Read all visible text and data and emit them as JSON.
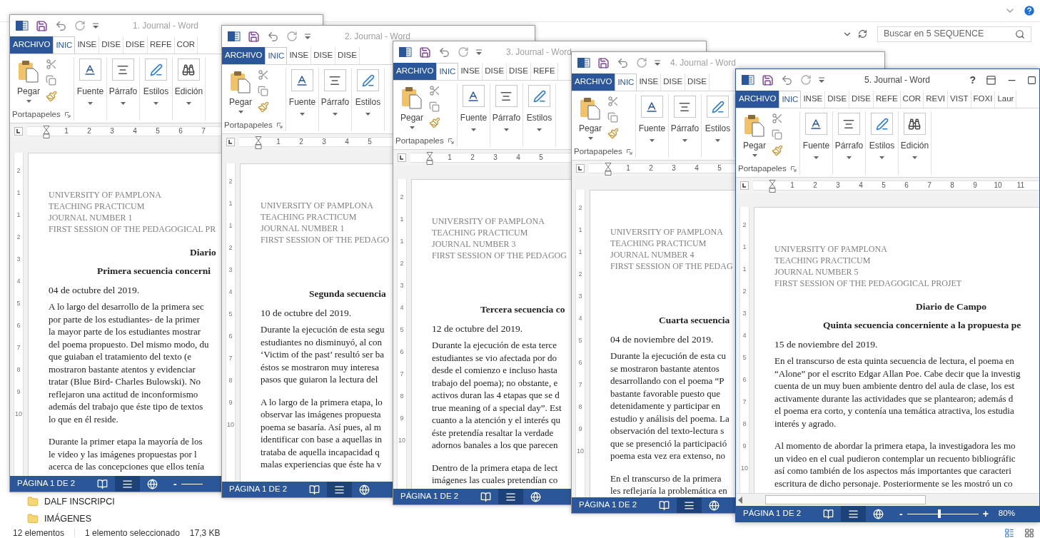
{
  "explorer": {
    "search": {
      "placeholder": "Buscar en 5 SEQUENCE"
    },
    "folders": [
      {
        "name": "DALF INSCRIPCI"
      },
      {
        "name": "IMÁGENES"
      }
    ],
    "status": {
      "count": "12 elementos",
      "selection": "1 elemento seleccionado",
      "size": "17,3 KB"
    }
  },
  "windows": [
    {
      "title": "1. Journal - Word",
      "active": false,
      "tabs": [
        {
          "label": "ARCHIVO",
          "kind": "file",
          "selected": false
        },
        {
          "label": "INIC",
          "kind": "tab",
          "selected": true
        },
        {
          "label": "INSE",
          "kind": "tab",
          "selected": false
        },
        {
          "label": "DISE",
          "kind": "tab",
          "selected": false
        },
        {
          "label": "DISE",
          "kind": "tab",
          "selected": false
        },
        {
          "label": "REFE",
          "kind": "tab",
          "selected": false
        },
        {
          "label": "COR",
          "kind": "tab",
          "selected": false
        }
      ],
      "clipboard": {
        "paste": "Pegar",
        "group": "Portapapeles"
      },
      "commands": [
        {
          "label": "Fuente",
          "kind": "font"
        },
        {
          "label": "Párrafo",
          "kind": "paragraph"
        },
        {
          "label": "Estilos",
          "kind": "styles"
        },
        {
          "label": "Edición",
          "kind": "editing"
        }
      ],
      "ruler": [
        "1",
        "2",
        "3",
        "4",
        "5",
        "6",
        "7"
      ],
      "vruler": [
        "2",
        "1",
        "1",
        "2",
        "3",
        "4",
        "5",
        "6",
        "7",
        "8",
        "9",
        "10"
      ],
      "document": {
        "header": [
          "UNIVERSITY OF PAMPLONA",
          "TEACHING PRACTICUM",
          "JOURNAL NUMBER 1",
          "FIRST SESSION OF THE PEDAGOGICAL PR"
        ],
        "title": "Diario",
        "subtitle": "Primera secuencia concerni",
        "date": "04 de octubre del 2019.",
        "paragraphs": [
          [
            "A lo largo del desarrollo de la primera sec",
            "por parte de los estudiantes- de la primer",
            "la mayor parte de los estudiantes mostrar",
            "del poema propuesto. Del mismo modo, du",
            "que guiaban el tratamiento del texto (e",
            "mostraron bastante atentos y evidenciar",
            "tratar (Blue Bird- Charles Bulowski). No",
            "reflejaron una actitud de inconformismo",
            "además del trabajo que éste tipo de textos",
            "lo que en él reside."
          ],
          [
            "Durante la primer etapa la mayoría de los",
            "le video y las imágenes propuestas por l",
            "acerca de las concepciones que ellos tenía"
          ]
        ]
      },
      "status": {
        "page": "PÁGINA 1 DE 2",
        "views": [
          {
            "kind": "read",
            "selected": false
          },
          {
            "kind": "print",
            "selected": true
          },
          {
            "kind": "web",
            "selected": false
          }
        ],
        "zoom": {
          "minus": "-"
        }
      }
    },
    {
      "title": "2. Journal - Word",
      "active": false,
      "tabs": [
        {
          "label": "ARCHIVO",
          "kind": "file",
          "selected": false
        },
        {
          "label": "INIC",
          "kind": "tab",
          "selected": true
        },
        {
          "label": "INSE",
          "kind": "tab",
          "selected": false
        },
        {
          "label": "DISE",
          "kind": "tab",
          "selected": false
        },
        {
          "label": "DISE",
          "kind": "tab",
          "selected": false
        }
      ],
      "clipboard": {
        "paste": "Pegar",
        "group": "Portapapeles"
      },
      "commands": [
        {
          "label": "Fuente",
          "kind": "font"
        },
        {
          "label": "Párrafo",
          "kind": "paragraph"
        },
        {
          "label": "Estilos",
          "kind": "styles"
        }
      ],
      "ruler": [
        "1",
        "2",
        "3",
        "4",
        "5"
      ],
      "vruler": [
        "2",
        "1",
        "1",
        "2",
        "3",
        "4",
        "5",
        "6",
        "7",
        "8",
        "9",
        "10"
      ],
      "document": {
        "header": [
          "UNIVERSITY OF PAMPLONA",
          "TEACHING PRACTICUM",
          "JOURNAL NUMBER 1",
          "FIRST SESSION OF THE PEDAGO"
        ],
        "subtitle": "Segunda secuencia",
        "date": "10 de octubre del 2019.",
        "paragraphs": [
          [
            "Durante la ejecución de esta segu",
            "estudiantes no disminuyó, al con",
            "‘Victim of the past’ resultó ser ba",
            "éstos se mostraron muy interesa",
            "pasos que guiaron la lectura del"
          ],
          [
            "A lo largo de la primera etapa, lo",
            "observar las imágenes propuesta",
            "poema se basaría. Así pues, al m",
            "identificar con base a aquellas in",
            "trataba de aquella incapacidad q",
            "malas experiencias que éste ha v"
          ]
        ]
      },
      "status": {
        "page": "PÁGINA 1 DE 2",
        "views": [
          {
            "kind": "read",
            "selected": false
          },
          {
            "kind": "print",
            "selected": true
          },
          {
            "kind": "web",
            "selected": false
          }
        ]
      }
    },
    {
      "title": "3. Journal - Word",
      "active": false,
      "tabs": [
        {
          "label": "ARCHIVO",
          "kind": "file",
          "selected": false
        },
        {
          "label": "INIC",
          "kind": "tab",
          "selected": true
        },
        {
          "label": "INSE",
          "kind": "tab",
          "selected": false
        },
        {
          "label": "DISE",
          "kind": "tab",
          "selected": false
        },
        {
          "label": "DISE",
          "kind": "tab",
          "selected": false
        },
        {
          "label": "REFE",
          "kind": "tab",
          "selected": false
        }
      ],
      "clipboard": {
        "paste": "Pegar",
        "group": "Portapapeles"
      },
      "commands": [
        {
          "label": "Fuente",
          "kind": "font"
        },
        {
          "label": "Párrafo",
          "kind": "paragraph"
        },
        {
          "label": "Estilos",
          "kind": "styles"
        }
      ],
      "ruler": [
        "1",
        "2",
        "3",
        "4",
        "5"
      ],
      "vruler": [
        "2",
        "1",
        "1",
        "2",
        "3",
        "4",
        "5",
        "6",
        "7",
        "8",
        "9",
        "10"
      ],
      "document": {
        "header": [
          "UNIVERSITY OF PAMPLONA",
          "TEACHING PRACTICUM",
          "JOURNAL NUMBER 3",
          "FIRST SESSION OF THE PEDAGOG"
        ],
        "subtitle": "Tercera secuencia co",
        "date": "12 de octubre del 2019.",
        "paragraphs": [
          [
            "Durante la ejecución de esta terce",
            "estudiantes se vio afectada por do",
            "desde el comienzo e incluso hasta",
            "trabajo del poema); no obstante, e",
            "activos duran las 4 etapas que se d",
            "true meaning of a special day”. Est",
            "cuanto a la atención y el interés qu",
            "éste pretendía resaltar la verdade",
            "adornos banales a los que parecen"
          ],
          [
            "Dentro de la primera etapa de lect",
            "imágenes las cuales pretendían co"
          ]
        ]
      },
      "status": {
        "page": "PÁGINA 1 DE 2",
        "views": [
          {
            "kind": "read",
            "selected": false
          },
          {
            "kind": "print",
            "selected": true
          },
          {
            "kind": "web",
            "selected": false
          }
        ]
      }
    },
    {
      "title": "4. Journal - Word",
      "active": false,
      "tabs": [
        {
          "label": "ARCHIVO",
          "kind": "file",
          "selected": false
        },
        {
          "label": "INIC",
          "kind": "tab",
          "selected": true
        },
        {
          "label": "INSE",
          "kind": "tab",
          "selected": false
        },
        {
          "label": "DISE",
          "kind": "tab",
          "selected": false
        },
        {
          "label": "DISE",
          "kind": "tab",
          "selected": false
        }
      ],
      "clipboard": {
        "paste": "Pegar",
        "group": "Portapapeles"
      },
      "commands": [
        {
          "label": "Fuente",
          "kind": "font"
        },
        {
          "label": "Párrafo",
          "kind": "paragraph"
        },
        {
          "label": "Estilos",
          "kind": "styles"
        }
      ],
      "ruler": [
        "1",
        "2",
        "3",
        "4",
        "5"
      ],
      "vruler": [
        "2",
        "1",
        "1",
        "2",
        "3",
        "4",
        "5",
        "6",
        "7",
        "8",
        "9",
        "10"
      ],
      "document": {
        "header": [
          "UNIVERSITY OF PAMPLONA",
          "TEACHING PRACTICUM",
          "JOURNAL NUMBER 4",
          "FIRST SESSION OF THE PEDAG"
        ],
        "subtitle": "Cuarta secuencia",
        "date": "04 de noviembre del 2019.",
        "paragraphs": [
          [
            "Durante la ejecución de esta cu",
            "se mostraron bastante atentos",
            "desarrollando con el poema “P",
            "bastante favorable puesto que",
            "detenidamente y participar en",
            "estudio y análisis del poema. La",
            "observación del texto-lectura s",
            "que se presenció la participació",
            "poema esta vez era extenso, no"
          ],
          [
            "En el transcurso de la primera",
            "les reflejaría la problemática en"
          ]
        ]
      },
      "status": {
        "page": "PÁGINA 1 DE 2",
        "views": [
          {
            "kind": "read",
            "selected": false
          },
          {
            "kind": "print",
            "selected": true
          },
          {
            "kind": "web",
            "selected": false
          }
        ]
      }
    },
    {
      "title": "5. Journal - Word",
      "active": true,
      "help": "?",
      "scrollbar": true,
      "tabs": [
        {
          "label": "ARCHIVO",
          "kind": "file",
          "selected": false
        },
        {
          "label": "INIC",
          "kind": "tab",
          "selected": true
        },
        {
          "label": "INSE",
          "kind": "tab",
          "selected": false
        },
        {
          "label": "DISE",
          "kind": "tab",
          "selected": false
        },
        {
          "label": "DISE",
          "kind": "tab",
          "selected": false
        },
        {
          "label": "REFE",
          "kind": "tab",
          "selected": false
        },
        {
          "label": "COR",
          "kind": "tab",
          "selected": false
        },
        {
          "label": "REVI",
          "kind": "tab",
          "selected": false
        },
        {
          "label": "VIST",
          "kind": "tab",
          "selected": false
        },
        {
          "label": "FOXI",
          "kind": "tab",
          "selected": false
        },
        {
          "label": "Laur",
          "kind": "tab",
          "selected": false
        }
      ],
      "clipboard": {
        "paste": "Pegar",
        "group": "Portapapeles"
      },
      "commands": [
        {
          "label": "Fuente",
          "kind": "font"
        },
        {
          "label": "Párrafo",
          "kind": "paragraph"
        },
        {
          "label": "Estilos",
          "kind": "styles"
        },
        {
          "label": "Edición",
          "kind": "editing"
        }
      ],
      "ruler": [
        "1",
        "2",
        "3",
        "4",
        "5",
        "6",
        "7",
        "8",
        "9",
        "10",
        "11"
      ],
      "vruler": [
        "2",
        "1",
        "1",
        "2",
        "3",
        "4",
        "5",
        "6",
        "7",
        "8",
        "9",
        "10"
      ],
      "document": {
        "header": [
          "UNIVERSITY OF PAMPLONA",
          "TEACHING PRACTICUM",
          "JOURNAL NUMBER 5",
          "FIRST SESSION OF THE PEDAGOGICAL PROJET"
        ],
        "title": "Diario de Campo",
        "subtitle": "Quinta secuencia concerniente a la propuesta pe",
        "date": "15 de noviembre del 2019.",
        "paragraphs": [
          [
            "En el transcurso de esta quinta secuencia de lectura, el poema en",
            "“Alone” por el escrito Edgar Allan Poe. Cabe decir que la investig",
            "cuenta de un muy buen ambiente dentro del aula de clase, los est",
            "activamente durante las actividades que se plantearon; además d",
            "el poema era corto, y contenía una temática atractiva, los estudia",
            "interés y agrado."
          ],
          [
            "Al momento de abordar la primera etapa, la investigadora les mo",
            "un video en el cual pudieron contemplar un recuento bibliográfic",
            "así como también de los aspectos más importantes que caracteri",
            "escritura de dicho personaje. Posteriormente se les mostró un co"
          ]
        ]
      },
      "status": {
        "page": "PÁGINA 1 DE 2",
        "views": [
          {
            "kind": "read",
            "selected": false
          },
          {
            "kind": "print",
            "selected": true
          },
          {
            "kind": "web",
            "selected": false
          }
        ],
        "zoom": {
          "minus": "-",
          "plus": "+",
          "level": 0.45,
          "percent": "80%"
        }
      }
    }
  ]
}
